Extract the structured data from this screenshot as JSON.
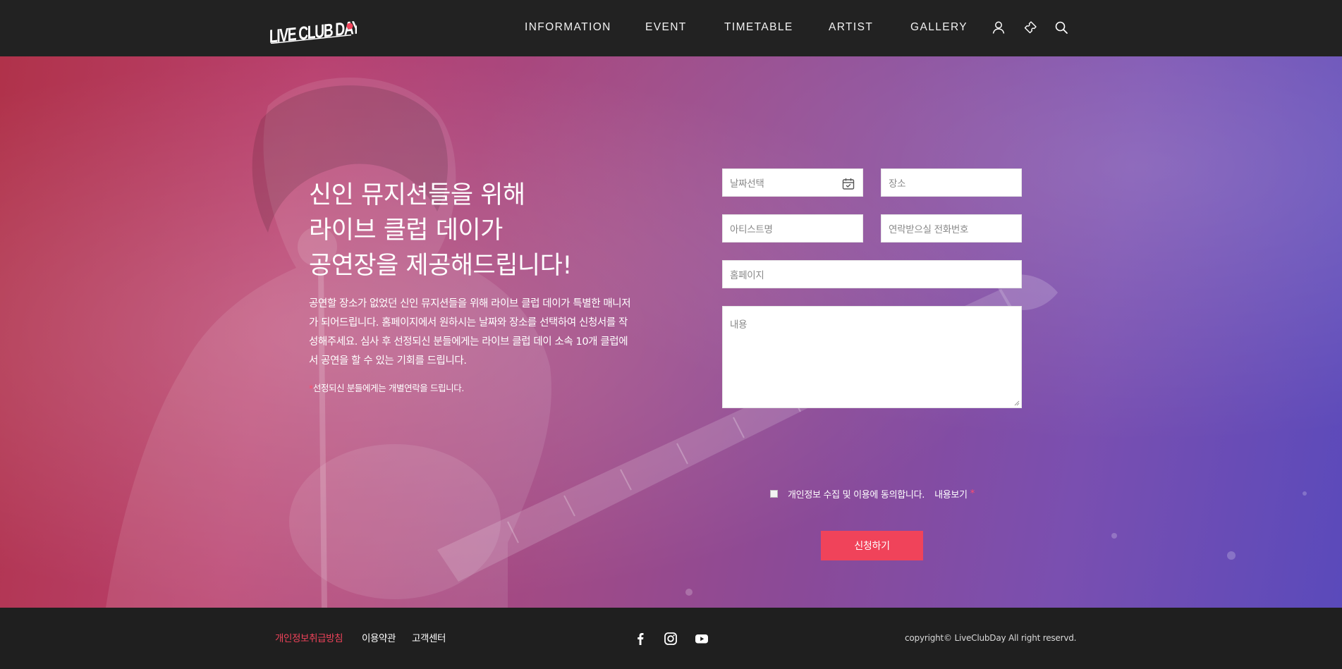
{
  "brand": {
    "logo_text": "LIVE CLUB DAY"
  },
  "nav": {
    "items": [
      {
        "label": "INFORMATION"
      },
      {
        "label": "EVENT"
      },
      {
        "label": "TIMETABLE"
      },
      {
        "label": "ARTIST"
      },
      {
        "label": "GALLERY"
      }
    ],
    "icons": [
      "user-icon",
      "ticket-icon",
      "search-icon"
    ]
  },
  "hero": {
    "headline": [
      "신인 뮤지션들을 위해",
      "라이브 클럽 데이가",
      "공연장을 제공해드립니다!"
    ],
    "description": "공연할 장소가 없었던 신인 뮤지션들을 위해 라이브 클럽 데이가 특별한 매니저가 되어드립니다. 홈페이지에서 원하시는 날짜와 장소를 선택하여 신청서를 작성해주세요. 심사 후 선정되신 분들에게는 라이브 클럽 데이 소속 10개 클럽에서 공연을 할 수 있는 기회를 드립니다.",
    "note_marker": "*",
    "note": "선정되신 분들에게는 개별연락을 드립니다."
  },
  "form": {
    "date_placeholder": "날짜선택",
    "place_placeholder": "장소",
    "artist_placeholder": "아티스트명",
    "phone_placeholder": "연락받으실 전화번호",
    "homepage_placeholder": "홈페이지",
    "content_placeholder": "내용",
    "consent_text": "개인정보 수집 및 이용에 동의합니다.",
    "consent_view": "내용보기",
    "consent_required": "*",
    "consent_checked": false,
    "submit_label": "신청하기"
  },
  "footer": {
    "links": [
      "개인정보취급방침",
      "이용약관",
      "고객센터"
    ],
    "social": [
      "facebook-icon",
      "instagram-icon",
      "youtube-icon"
    ],
    "copyright": "copyright© LiveClubDay All right reservd."
  },
  "colors": {
    "header_bg": "#222222",
    "accent": "#f0435a",
    "footer_bg": "#1f1f1f",
    "hero_gradient_start": "#b0324a",
    "hero_gradient_end": "#5a4abb"
  }
}
